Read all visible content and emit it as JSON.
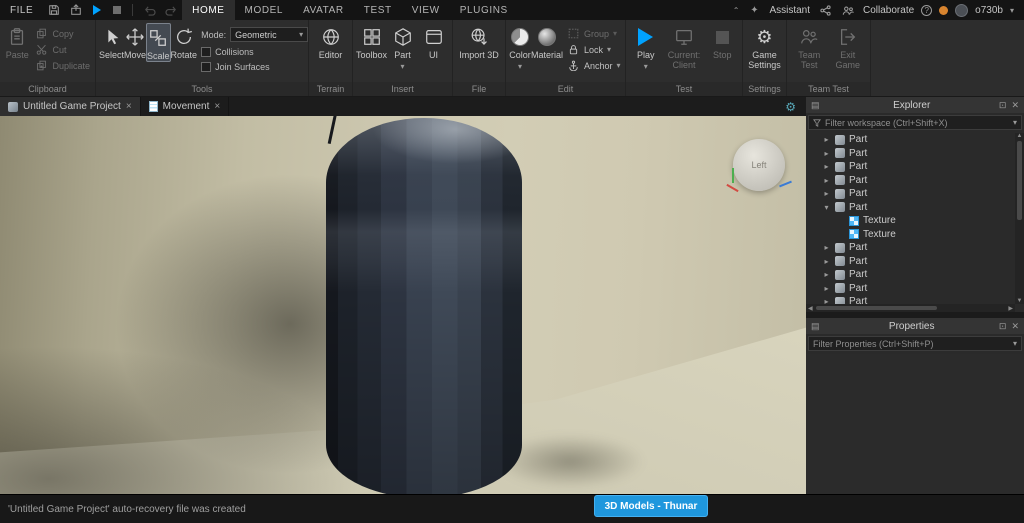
{
  "colors": {
    "accent_blue": "#00a2ff",
    "taskbar_blue": "#1f97dd"
  },
  "menubar": {
    "file": "FILE",
    "tabs": [
      "HOME",
      "MODEL",
      "AVATAR",
      "TEST",
      "VIEW",
      "PLUGINS"
    ],
    "active_tab": "HOME",
    "assistant": "Assistant",
    "collaborate": "Collaborate",
    "username": "o730b"
  },
  "ribbon": {
    "clipboard": {
      "label": "Clipboard",
      "paste": "Paste",
      "copy": "Copy",
      "cut": "Cut",
      "duplicate": "Duplicate"
    },
    "tools": {
      "label": "Tools",
      "select": "Select",
      "move": "Move",
      "scale": "Scale",
      "rotate": "Rotate",
      "mode_label": "Mode:",
      "mode_value": "Geometric",
      "collisions": "Collisions",
      "join_surfaces": "Join Surfaces"
    },
    "terrain": {
      "label": "Terrain",
      "editor": "Editor"
    },
    "insert": {
      "label": "Insert",
      "toolbox": "Toolbox",
      "part": "Part",
      "ui": "UI"
    },
    "file": {
      "label": "File",
      "import_3d": "Import 3D"
    },
    "edit": {
      "label": "Edit",
      "color": "Color",
      "material": "Material",
      "group": "Group",
      "lock": "Lock",
      "anchor": "Anchor"
    },
    "test": {
      "label": "Test",
      "play": "Play",
      "current_client": "Current: Client",
      "stop": "Stop"
    },
    "settings": {
      "label": "Settings",
      "game_settings": "Game Settings"
    },
    "team_test": {
      "label": "Team Test",
      "team_test": "Team Test",
      "exit_game": "Exit Game"
    }
  },
  "doc_tabs": [
    {
      "label": "Untitled Game Project",
      "close": "×"
    },
    {
      "label": "Movement",
      "close": "×"
    }
  ],
  "viewport": {
    "view_cube_face": "Left"
  },
  "explorer": {
    "title": "Explorer",
    "filter_placeholder": "Filter workspace (Ctrl+Shift+X)",
    "tree": [
      {
        "label": "Part",
        "type": "part",
        "depth": 1,
        "arrow": "right"
      },
      {
        "label": "Part",
        "type": "part",
        "depth": 1,
        "arrow": "right"
      },
      {
        "label": "Part",
        "type": "part",
        "depth": 1,
        "arrow": "right"
      },
      {
        "label": "Part",
        "type": "part",
        "depth": 1,
        "arrow": "right"
      },
      {
        "label": "Part",
        "type": "part",
        "depth": 1,
        "arrow": "right"
      },
      {
        "label": "Part",
        "type": "part",
        "depth": 1,
        "arrow": "down"
      },
      {
        "label": "Texture",
        "type": "texture",
        "depth": 2,
        "arrow": "none"
      },
      {
        "label": "Texture",
        "type": "texture",
        "depth": 2,
        "arrow": "none"
      },
      {
        "label": "Part",
        "type": "part",
        "depth": 1,
        "arrow": "right"
      },
      {
        "label": "Part",
        "type": "part",
        "depth": 1,
        "arrow": "right"
      },
      {
        "label": "Part",
        "type": "part",
        "depth": 1,
        "arrow": "right"
      },
      {
        "label": "Part",
        "type": "part",
        "depth": 1,
        "arrow": "right"
      },
      {
        "label": "Part",
        "type": "part",
        "depth": 1,
        "arrow": "right"
      }
    ]
  },
  "properties": {
    "title": "Properties",
    "filter_placeholder": "Filter Properties (Ctrl+Shift+P)"
  },
  "statusbar": {
    "message": "'Untitled Game Project' auto-recovery file was created"
  },
  "taskbar": {
    "window_button": "3D Models - Thunar"
  }
}
